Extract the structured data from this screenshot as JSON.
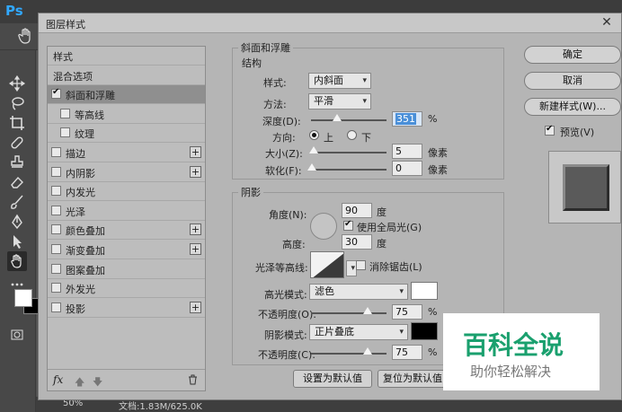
{
  "app": {
    "logo": "Ps"
  },
  "status": {
    "zoom": "50%",
    "doc": "文档:1.83M/625.0K"
  },
  "dialog": {
    "title": "图层样式",
    "styles_list": {
      "items": [
        {
          "label": "样式",
          "checkbox": false
        },
        {
          "label": "混合选项",
          "checkbox": false
        },
        {
          "label": "斜面和浮雕",
          "checkbox": true,
          "checked": true,
          "selected": true
        },
        {
          "label": "等高线",
          "checkbox": true,
          "checked": false,
          "sub": true
        },
        {
          "label": "纹理",
          "checkbox": true,
          "checked": false,
          "sub": true
        },
        {
          "label": "描边",
          "checkbox": true,
          "checked": false,
          "plus": true
        },
        {
          "label": "内阴影",
          "checkbox": true,
          "checked": false,
          "plus": true
        },
        {
          "label": "内发光",
          "checkbox": true,
          "checked": false
        },
        {
          "label": "光泽",
          "checkbox": true,
          "checked": false
        },
        {
          "label": "颜色叠加",
          "checkbox": true,
          "checked": false,
          "plus": true
        },
        {
          "label": "渐变叠加",
          "checkbox": true,
          "checked": false,
          "plus": true
        },
        {
          "label": "图案叠加",
          "checkbox": true,
          "checked": false
        },
        {
          "label": "外发光",
          "checkbox": true,
          "checked": false
        },
        {
          "label": "投影",
          "checkbox": true,
          "checked": false,
          "plus": true
        }
      ],
      "footer_fx": "fx"
    },
    "bevel": {
      "section_title": "斜面和浮雕",
      "structure_title": "结构",
      "style_label": "样式:",
      "style_value": "内斜面",
      "technique_label": "方法:",
      "technique_value": "平滑",
      "depth_label": "深度(D):",
      "depth_value": "351",
      "depth_percent": 0.35,
      "depth_unit": "%",
      "direction_label": "方向:",
      "direction_up": "上",
      "direction_down": "下",
      "size_label": "大小(Z):",
      "size_value": "5",
      "size_unit": "像素",
      "soften_label": "软化(F):",
      "soften_value": "0",
      "soften_unit": "像素",
      "shading_title": "阴影",
      "angle_label": "角度(N):",
      "angle_value": "90",
      "angle_unit": "度",
      "global_light_label": "使用全局光(G)",
      "altitude_label": "高度:",
      "altitude_value": "30",
      "altitude_unit": "度",
      "gloss_label": "光泽等高线:",
      "antialias_label": "消除锯齿(L)",
      "highlight_mode_label": "高光模式:",
      "highlight_mode_value": "滤色",
      "highlight_color": "#ffffff",
      "highlight_opacity_label": "不透明度(O):",
      "highlight_opacity_value": "75",
      "shadow_mode_label": "阴影模式:",
      "shadow_mode_value": "正片叠底",
      "shadow_color": "#000000",
      "shadow_opacity_label": "不透明度(C):",
      "shadow_opacity_value": "75",
      "percent": "%",
      "make_default": "设置为默认值",
      "reset_default": "复位为默认值"
    },
    "buttons": {
      "ok": "确定",
      "cancel": "取消",
      "new_style": "新建样式(W)...",
      "preview_label": "预览(V)"
    }
  },
  "watermark": {
    "main": "百科全说",
    "sub": "助你轻松解决"
  }
}
